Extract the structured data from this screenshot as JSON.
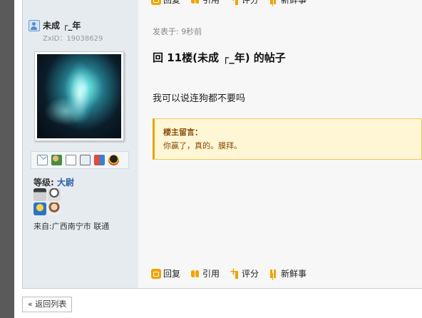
{
  "user": {
    "name": "未成 ┌_年",
    "zxid": "ZxID：19038629",
    "level_label": "等级:",
    "level_value": "大尉",
    "location": "来自:广西南宁市  联通"
  },
  "post": {
    "time": "发表于: 9秒前",
    "title": "回  11楼(未成 ┌_年) 的帖子",
    "body": "我可以说连狗都不要吗",
    "note_title": "楼主留言：",
    "note_text": "你赢了，真的。膜拜。"
  },
  "actions": {
    "reply": "回复",
    "quote": "引用",
    "rate": "评分",
    "news": "新鲜事"
  },
  "footer": {
    "back": "« 返回列表"
  },
  "icons": [
    "user-icon",
    "mail-icon",
    "add-friend-icon",
    "search-icon",
    "profile-card-icon",
    "blocks-icon",
    "qq-icon"
  ],
  "colors": {
    "sidebar_bg": "#e6ebf0",
    "post_bg": "#f7f7f7",
    "accent": "#f0a400",
    "note_bg": "#fff6d6",
    "level_color": "#2b5fa6"
  }
}
